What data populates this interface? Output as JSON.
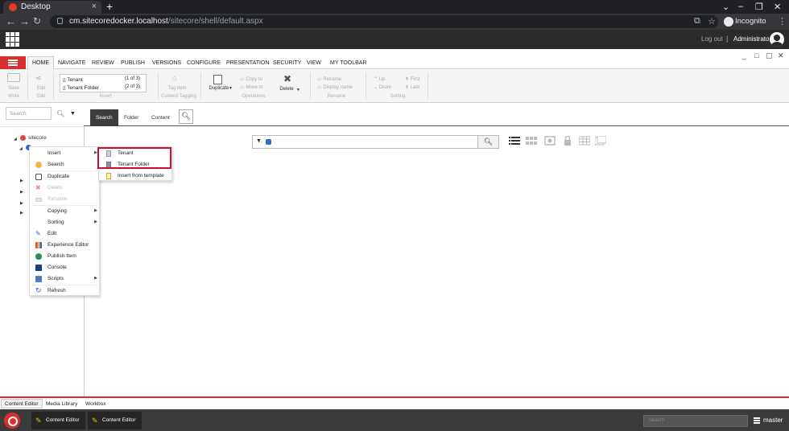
{
  "browser": {
    "tab_title": "Desktop",
    "new_tab": "+",
    "url_host": "cm.sitecoredocker.localhost",
    "url_path": "/sitecore/shell/default.aspx",
    "profile_label": "Incognito"
  },
  "header": {
    "logout": "Log out",
    "separator": "|",
    "user": "Administrator"
  },
  "ribbon": {
    "tabs": [
      "HOME",
      "NAVIGATE",
      "REVIEW",
      "PUBLISH",
      "VERSIONS",
      "CONFIGURE",
      "PRESENTATION",
      "SECURITY",
      "VIEW",
      "MY TOOLBAR"
    ],
    "groups": {
      "write": {
        "save": "Save",
        "label": "Write"
      },
      "edit": {
        "edit": "Edit",
        "label": "Edit"
      },
      "insert": {
        "label": "Insert",
        "items": [
          {
            "name": "Tenant",
            "count": "(1 of 3)"
          },
          {
            "name": "Tenant Folder",
            "count": "(2 of 3)"
          }
        ]
      },
      "tagging": {
        "tag_item": "Tag item",
        "label": "Content Tagging"
      },
      "operations": {
        "duplicate": "Duplicate",
        "copy_to": "Copy to",
        "move_to": "Move to",
        "delete": "Delete",
        "label": "Operations"
      },
      "rename": {
        "rename": "Rename",
        "display_name": "Display name",
        "label": "Rename"
      },
      "sorting": {
        "up": "Up",
        "down": "Down",
        "first": "First",
        "last": "Last",
        "label": "Sorting"
      }
    }
  },
  "tree": {
    "search_placeholder": "Search",
    "root": "sitecore"
  },
  "content_tabs": [
    "Search",
    "Folder",
    "Content"
  ],
  "context_menu": {
    "items": [
      {
        "label": "Insert",
        "has_submenu": true,
        "enabled": true
      },
      {
        "label": "Search",
        "has_submenu": false,
        "enabled": true
      },
      {
        "label": "Duplicate",
        "has_submenu": false,
        "enabled": true
      },
      {
        "label": "Delete",
        "has_submenu": false,
        "enabled": false
      },
      {
        "label": "Rename",
        "has_submenu": false,
        "enabled": false
      },
      {
        "label": "Copying",
        "has_submenu": true,
        "enabled": true
      },
      {
        "label": "Sorting",
        "has_submenu": true,
        "enabled": true
      },
      {
        "label": "Edit",
        "has_submenu": false,
        "enabled": true
      },
      {
        "label": "Experience Editor",
        "has_submenu": false,
        "enabled": true
      },
      {
        "label": "Publish Item",
        "has_submenu": false,
        "enabled": true
      },
      {
        "label": "Console",
        "has_submenu": false,
        "enabled": true
      },
      {
        "label": "Scripts",
        "has_submenu": true,
        "enabled": true
      },
      {
        "label": "Refresh",
        "has_submenu": false,
        "enabled": true
      }
    ]
  },
  "insert_submenu": {
    "items": [
      "Tenant",
      "Tenant Folder",
      "Insert from template"
    ]
  },
  "bottom_tabs": [
    "Content Editor",
    "Media Library",
    "Workbox"
  ],
  "taskbar": {
    "buttons": [
      "Content Editor",
      "Content Editor"
    ],
    "search_placeholder": "Search",
    "database": "master"
  },
  "colors": {
    "accent": "#d8302c",
    "highlight_box": "#c8102e"
  }
}
